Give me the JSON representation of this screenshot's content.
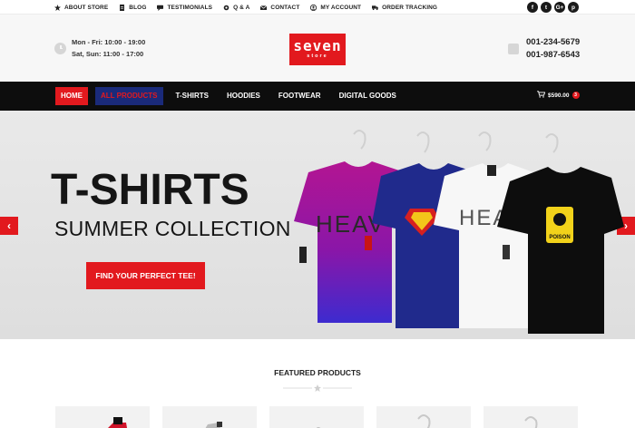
{
  "topbar": {
    "links": [
      {
        "label": "ABOUT STORE",
        "icon": "star-icon"
      },
      {
        "label": "BLOG",
        "icon": "document-icon"
      },
      {
        "label": "TESTIMONIALS",
        "icon": "chat-icon"
      },
      {
        "label": "Q & A",
        "icon": "gear-icon"
      },
      {
        "label": "CONTACT",
        "icon": "envelope-icon"
      },
      {
        "label": "MY ACCOUNT",
        "icon": "user-icon"
      },
      {
        "label": "ORDER TRACKING",
        "icon": "truck-icon"
      }
    ],
    "socials": [
      {
        "glyph": "f",
        "icon": "facebook-icon"
      },
      {
        "glyph": "t",
        "icon": "twitter-icon"
      },
      {
        "glyph": "G+",
        "icon": "googleplus-icon"
      },
      {
        "glyph": "p",
        "icon": "pinterest-icon"
      }
    ]
  },
  "header": {
    "hours": [
      "Mon - Fri: 10:00 - 19:00",
      "Sat, Sun: 11:00 - 17:00"
    ],
    "logo_main": "seven",
    "logo_sub": "store",
    "phones": [
      "001-234-5679",
      "001-987-6543"
    ]
  },
  "nav": {
    "items": [
      "HOME",
      "ALL PRODUCTS",
      "T-SHIRTS",
      "HOODIES",
      "FOOTWEAR",
      "DIGITAL GOODS"
    ],
    "cart_total": "$590.00",
    "cart_count": "3"
  },
  "hero": {
    "title": "T-SHIRTS",
    "subtitle": "SUMMER COLLECTION",
    "button": "FIND YOUR PERFECT TEE!",
    "shirt_print_1": "HEAV",
    "shirt_print_3": "HEAV",
    "shirt_badge": "POISON",
    "prev_arrow": "‹",
    "next_arrow": "›"
  },
  "featured": {
    "title": "FEATURED PRODUCTS"
  },
  "colors": {
    "accent": "#e2191e",
    "nav_bg": "#0d0d0d",
    "all_products_bg": "#1a2a7a"
  }
}
